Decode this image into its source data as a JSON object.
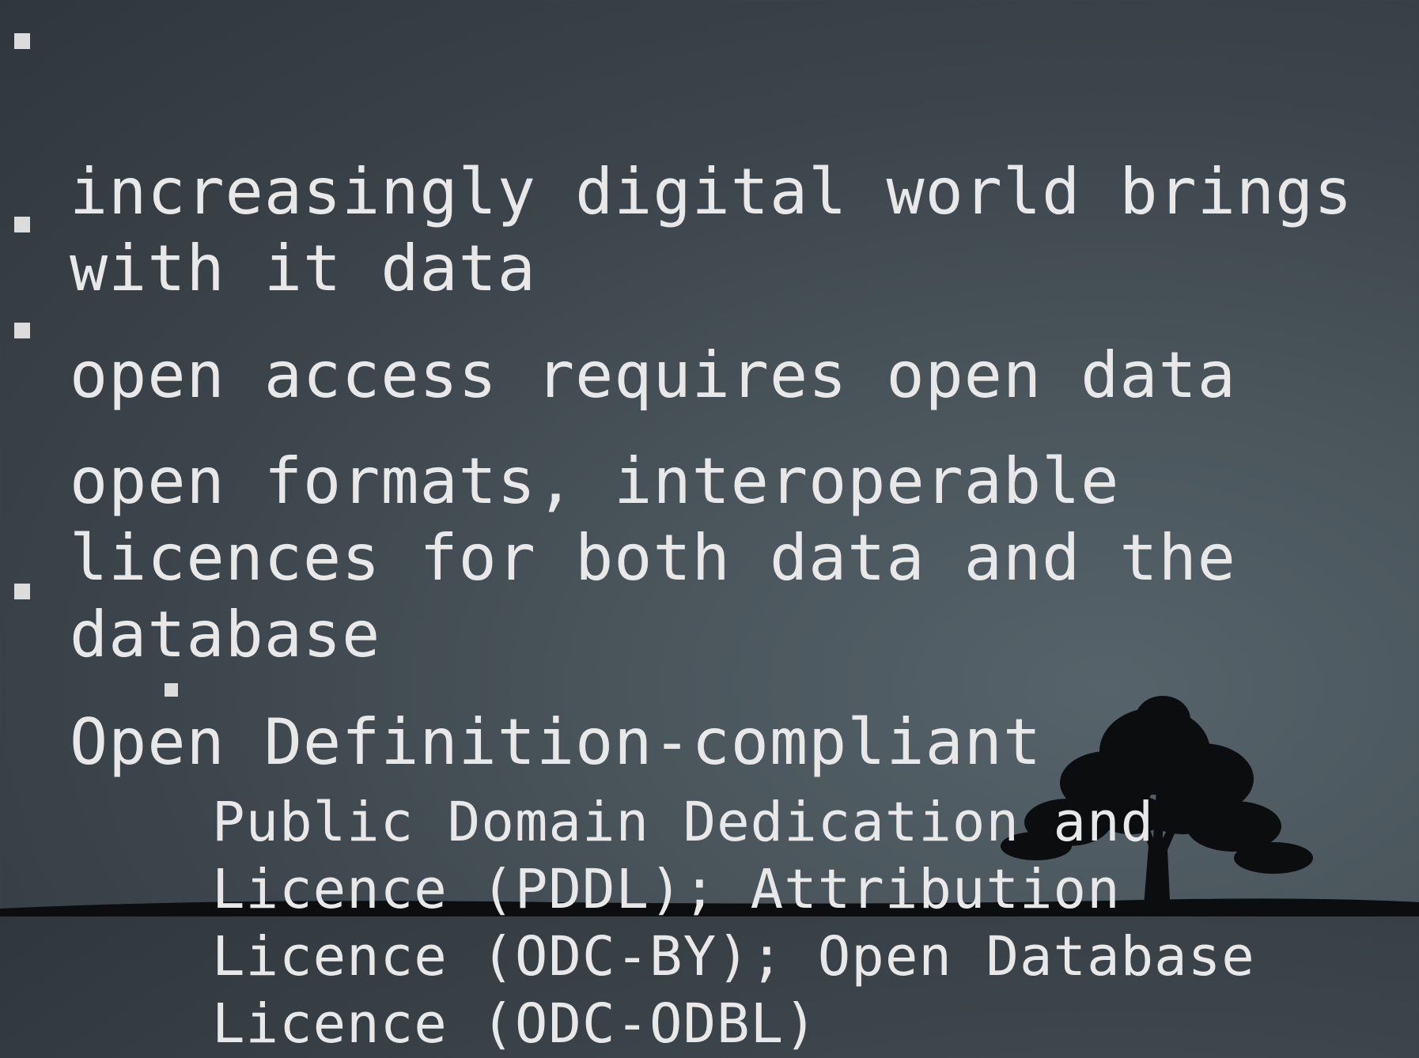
{
  "slide": {
    "bullets": [
      "increasingly digital world brings\nwith it data",
      "open access requires open data",
      "open formats, interoperable\nlicences for both data and the\ndatabase",
      "Open Definition-compliant"
    ],
    "sub_bullets": [
      "Public Domain Dedication and\nLicence (PDDL); Attribution\nLicence (ODC-BY); Open Database\nLicence (ODC-ODBL)"
    ]
  },
  "decor": {
    "tree_icon": "tree-silhouette-icon",
    "ground_icon": "hill-silhouette-icon",
    "bullet_icon": "square-bullet-icon",
    "background_color": "#3c454b",
    "text_color": "#e8e8e8"
  }
}
